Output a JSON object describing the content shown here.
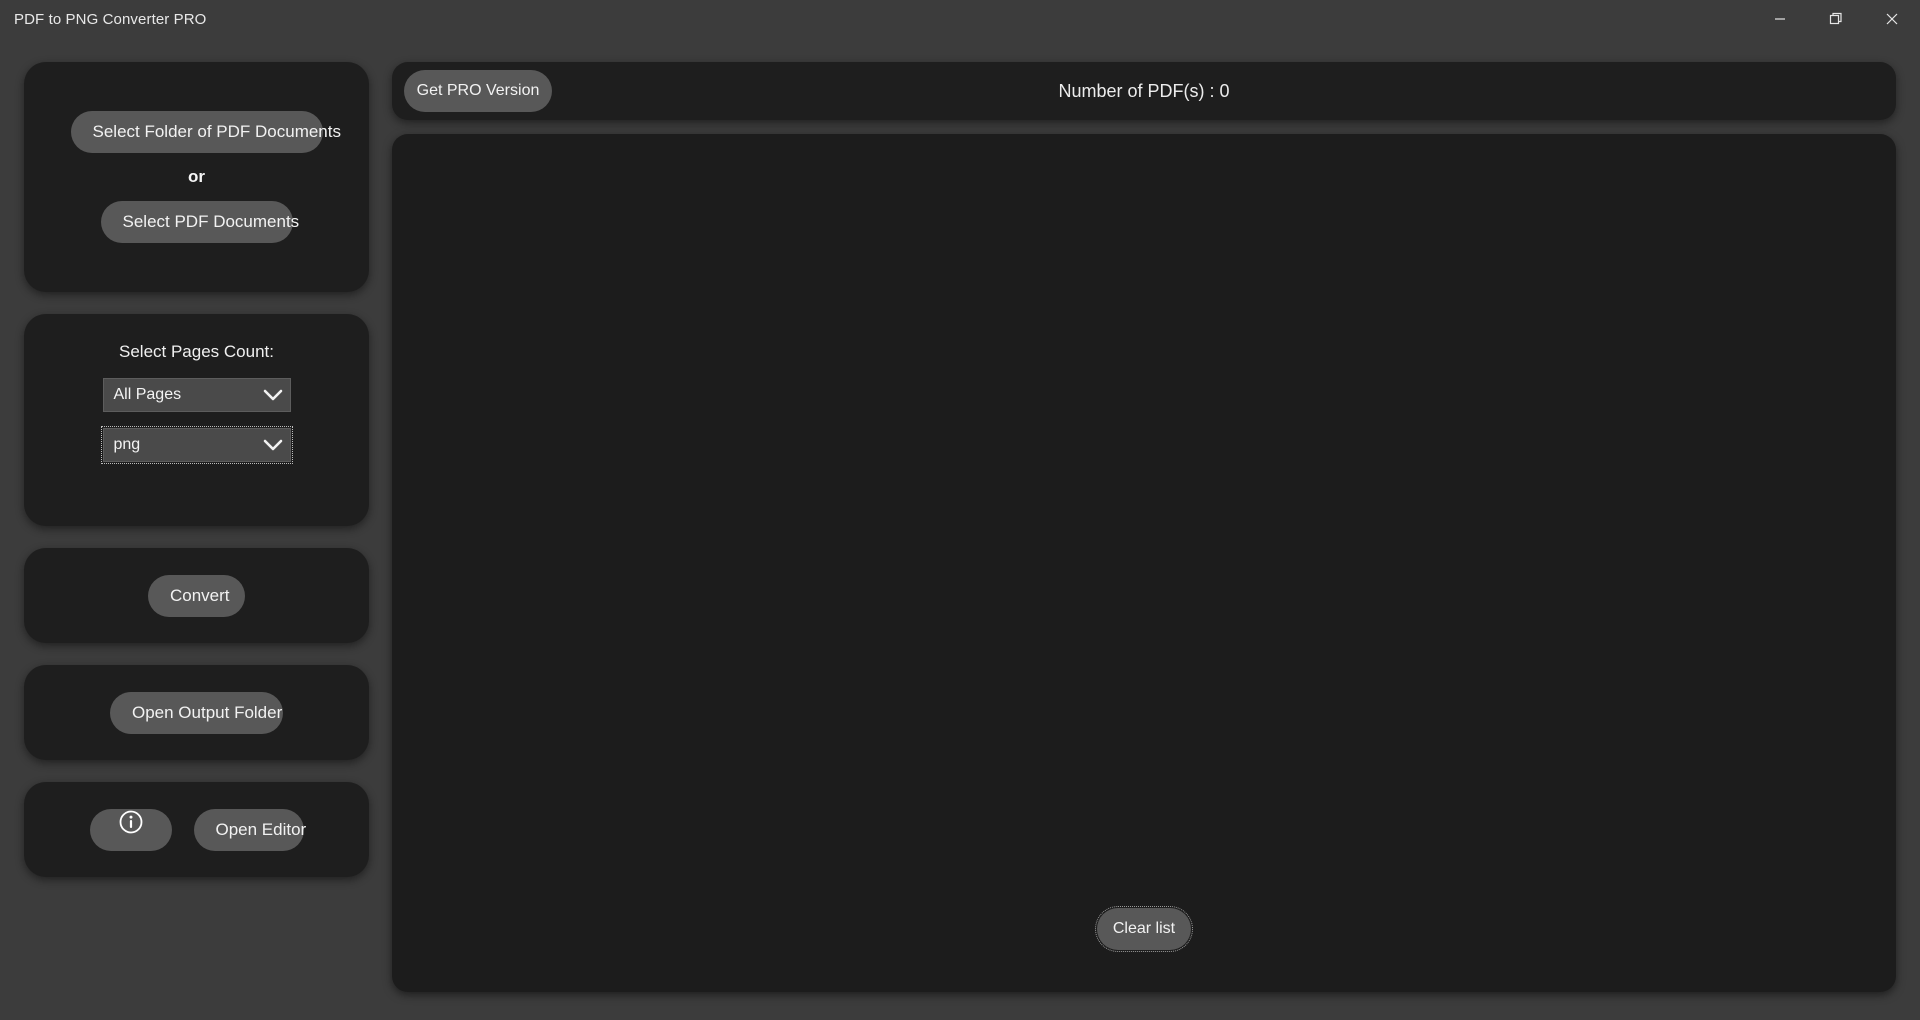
{
  "window": {
    "title": "PDF to PNG Converter PRO",
    "controls": {
      "minimize": "minimize-icon",
      "maximize": "restore-icon",
      "close": "close-icon"
    }
  },
  "sidebar": {
    "source_card": {
      "select_folder_label": "Select Folder of PDF Documents",
      "or_label": "or",
      "select_documents_label": "Select PDF Documents"
    },
    "options_card": {
      "pages_count_label": "Select Pages Count:",
      "pages_count_value": "All Pages",
      "pages_count_options": [
        "All Pages"
      ],
      "format_value": "png",
      "format_options": [
        "png"
      ]
    },
    "convert_card": {
      "convert_label": "Convert"
    },
    "output_card": {
      "open_output_folder_label": "Open Output Folder"
    },
    "tools_card": {
      "info_icon": "info-circle-icon",
      "open_editor_label": "Open Editor"
    }
  },
  "main": {
    "toolbar": {
      "get_pro_label": "Get PRO Version",
      "pdf_count_label": "Number of PDF(s) : 0"
    },
    "list_panel": {
      "items": [],
      "clear_list_label": "Clear list"
    }
  },
  "colors": {
    "app_background": "#3c3c3c",
    "card_background": "#1e1e1e",
    "panel_background": "#1c1c1c",
    "button_fill": "#585858",
    "combo_fill": "#4a4a4a",
    "text_primary": "#f2f2f2"
  }
}
